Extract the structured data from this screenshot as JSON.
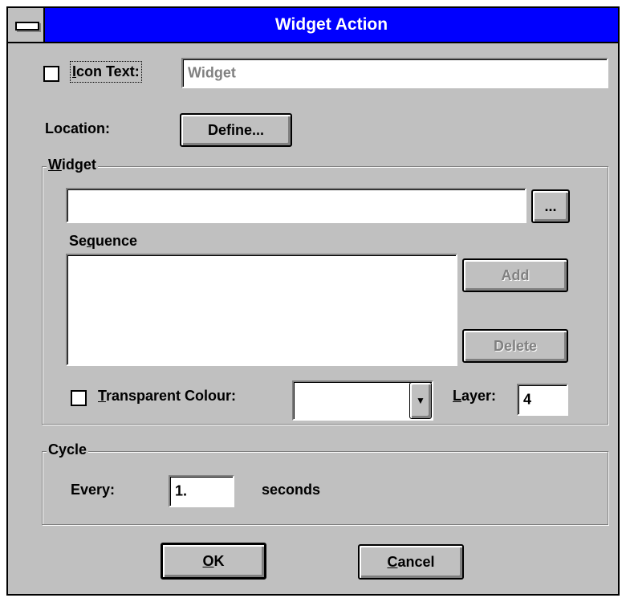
{
  "window": {
    "title": "Widget Action"
  },
  "icon_text": {
    "label": "Icon Text:",
    "checked": false,
    "value": "Widget"
  },
  "location": {
    "label": "Location:",
    "define_button": "Define..."
  },
  "widget_group": {
    "title": "Widget",
    "file_value": "",
    "browse_button": "...",
    "sequence_label": "Sequence",
    "sequence_items": [],
    "add_button": "Add",
    "delete_button": "Delete",
    "transparent_label": "Transparent Colour:",
    "transparent_checked": false,
    "colour_value": "",
    "layer_label": "Layer:",
    "layer_value": "4"
  },
  "cycle_group": {
    "title": "Cycle",
    "every_label": "Every:",
    "every_value": "1.",
    "unit_label": "seconds"
  },
  "buttons": {
    "ok": "OK",
    "cancel": "Cancel"
  },
  "colors": {
    "titlebar": "#0000ff",
    "face": "#c0c0c0",
    "disabled_text": "#808080"
  }
}
